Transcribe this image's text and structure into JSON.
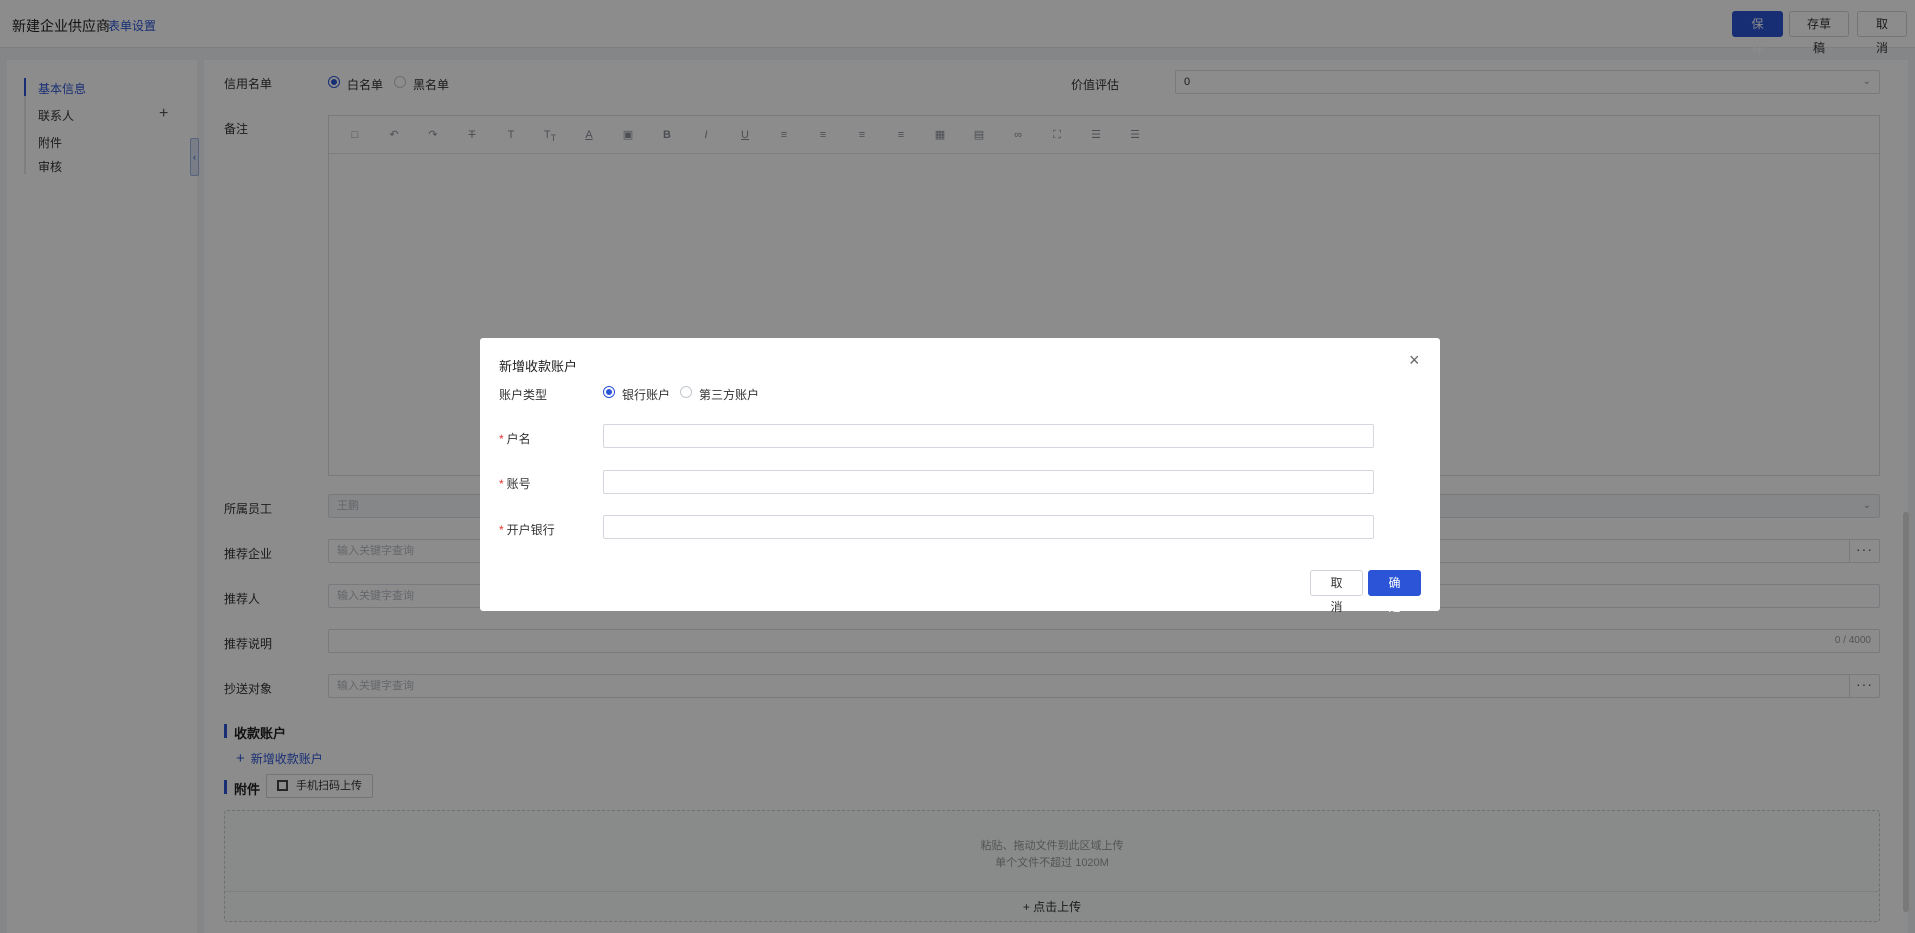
{
  "header": {
    "title": "新建企业供应商",
    "form_settings": "表单设置",
    "save": "保 存",
    "draft": "存草稿",
    "cancel": "取 消"
  },
  "sidebar": {
    "items": [
      {
        "label": "基本信息",
        "active": true
      },
      {
        "label": "联系人"
      },
      {
        "label": "附件"
      },
      {
        "label": "审核"
      }
    ]
  },
  "form": {
    "credit_label": "信用名单",
    "credit_options": [
      "白名单",
      "黑名单"
    ],
    "value_label": "价值评估",
    "value_value": "0",
    "remark_label": "备注",
    "employee_label": "所属员工",
    "employee_value": "王鹏",
    "ref_company_label": "推荐企业",
    "ref_company_placeholder": "输入关键字查询",
    "referrer_label": "推荐人",
    "referrer_placeholder": "输入关键字查询",
    "ref_desc_label": "推荐说明",
    "ref_desc_counter": "0 / 4000",
    "cc_label": "抄送对象",
    "cc_placeholder": "输入关键字查询",
    "account_section": "收款账户",
    "add_account": "新增收款账户",
    "attach_section": "附件",
    "qr_upload": "手机扫码上传",
    "upload_hint1": "粘贴、拖动文件到此区域上传",
    "upload_hint2": "单个文件不超过 1020M",
    "upload_click": "点击上传"
  },
  "dialog": {
    "title": "新增收款账户",
    "type_label": "账户类型",
    "type_options": [
      "银行账户",
      "第三方账户"
    ],
    "name_label": "户名",
    "account_label": "账号",
    "bank_label": "开户银行",
    "cancel": "取 消",
    "ok": "确 定"
  },
  "colors": {
    "accent": "#2b54d6",
    "required": "#e2362f"
  }
}
